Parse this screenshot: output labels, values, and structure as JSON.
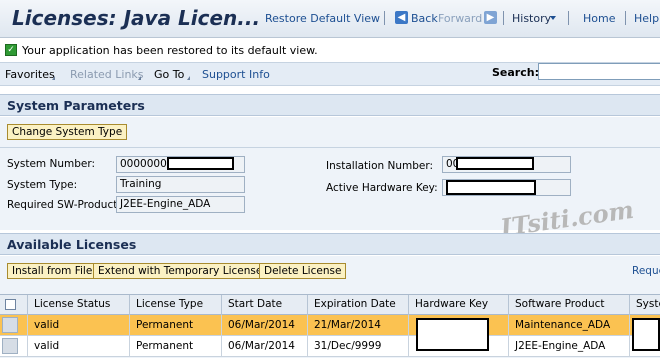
{
  "header": {
    "title": "Licenses: Java Licen...",
    "restore_default_view": "Restore Default View",
    "back": "Back",
    "forward": "Forward",
    "history": "History",
    "home": "Home",
    "help": "Help"
  },
  "message": {
    "text": "Your application has been restored to its default view.",
    "status_color": "#2f9a34"
  },
  "toolbar": {
    "favorites": "Favorites",
    "related_links": "Related Links",
    "go_to": "Go To",
    "support_info": "Support Info",
    "search_label": "Search:",
    "search_value": ""
  },
  "system_parameters": {
    "title": "System Parameters",
    "change_button": "Change System Type",
    "system_number_label": "System Number:",
    "system_number_value": "00000000",
    "system_type_label": "System Type:",
    "system_type_value": "Training",
    "required_sw_label": "Required SW-Product:",
    "required_sw_value": "J2EE-Engine_ADA",
    "installation_number_label": "Installation Number:",
    "installation_number_value": "00",
    "active_hw_key_label": "Active Hardware Key:",
    "active_hw_key_value": ""
  },
  "watermark": "ITsiti.com",
  "available_licenses": {
    "title": "Available Licenses",
    "install_button": "Install from File",
    "extend_button": "Extend with Temporary License",
    "delete_button": "Delete License",
    "request_link": "Reque",
    "columns": [
      "License Status",
      "License Type",
      "Start Date",
      "Expiration Date",
      "Hardware Key",
      "Software Product",
      "Syste"
    ],
    "rows": [
      {
        "status": "valid",
        "type": "Permanent",
        "start": "06/Mar/2014",
        "expiration": "21/Mar/2014",
        "hardware_key": "",
        "product": "Maintenance_ADA",
        "system": ""
      },
      {
        "status": "valid",
        "type": "Permanent",
        "start": "06/Mar/2014",
        "expiration": "31/Dec/9999",
        "hardware_key": "",
        "product": "J2EE-Engine_ADA",
        "system": ""
      }
    ],
    "selected_row_color": "#fbc251"
  }
}
